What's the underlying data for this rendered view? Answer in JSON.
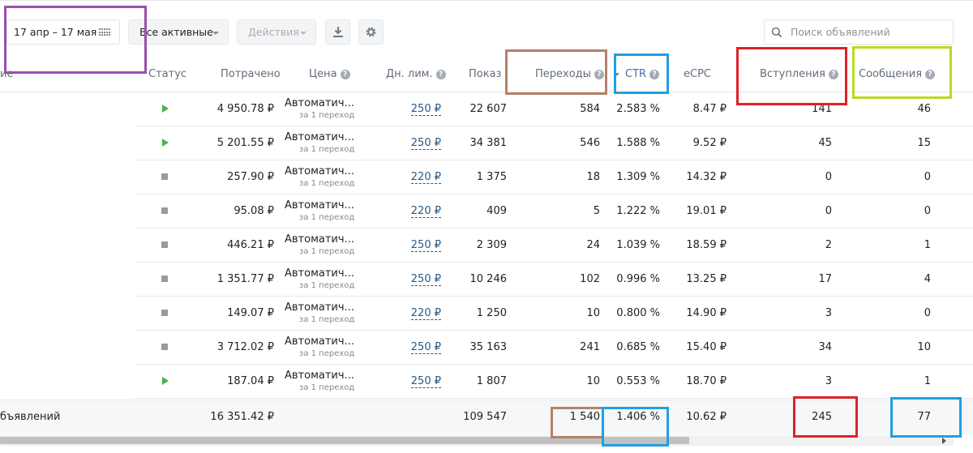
{
  "toolbar": {
    "date_range": "17 апр – 17 мая",
    "filter": "Все активные",
    "actions": "Действия",
    "search_placeholder": "Поиск объявлений"
  },
  "columns": {
    "name_partial": "ие",
    "status": "Статус",
    "spent": "Потрачено",
    "price": "Цена",
    "daily_limit": "Дн. лим.",
    "impressions": "Показ",
    "clicks": "Переходы",
    "ctr": "CTR",
    "ecpc": "eCPC",
    "joins": "Вступления",
    "messages": "Сообщения"
  },
  "rows": [
    {
      "status": "active",
      "spent": "4 950.78 ₽",
      "price": "Автоматич...",
      "price_sub": "за 1 переход",
      "limit": "250 ₽",
      "impressions": "22 607",
      "clicks": "584",
      "ctr": "2.583 %",
      "ecpc": "8.47 ₽",
      "joins": "141",
      "messages": "46"
    },
    {
      "status": "active",
      "spent": "5 201.55 ₽",
      "price": "Автоматич...",
      "price_sub": "за 1 переход",
      "limit": "250 ₽",
      "impressions": "34 381",
      "clicks": "546",
      "ctr": "1.588 %",
      "ecpc": "9.52 ₽",
      "joins": "45",
      "messages": "15"
    },
    {
      "status": "stopped",
      "spent": "257.90 ₽",
      "price": "Автоматич...",
      "price_sub": "за 1 переход",
      "limit": "220 ₽",
      "impressions": "1 375",
      "clicks": "18",
      "ctr": "1.309 %",
      "ecpc": "14.32 ₽",
      "joins": "0",
      "messages": "0"
    },
    {
      "status": "stopped",
      "spent": "95.08 ₽",
      "price": "Автоматич...",
      "price_sub": "за 1 переход",
      "limit": "220 ₽",
      "impressions": "409",
      "clicks": "5",
      "ctr": "1.222 %",
      "ecpc": "19.01 ₽",
      "joins": "0",
      "messages": "0"
    },
    {
      "status": "stopped",
      "spent": "446.21 ₽",
      "price": "Автоматич...",
      "price_sub": "за 1 переход",
      "limit": "250 ₽",
      "impressions": "2 309",
      "clicks": "24",
      "ctr": "1.039 %",
      "ecpc": "18.59 ₽",
      "joins": "2",
      "messages": "1"
    },
    {
      "status": "stopped",
      "spent": "1 351.77 ₽",
      "price": "Автоматич...",
      "price_sub": "за 1 переход",
      "limit": "250 ₽",
      "impressions": "10 246",
      "clicks": "102",
      "ctr": "0.996 %",
      "ecpc": "13.25 ₽",
      "joins": "17",
      "messages": "4"
    },
    {
      "status": "stopped",
      "spent": "149.07 ₽",
      "price": "Автоматич...",
      "price_sub": "за 1 переход",
      "limit": "220 ₽",
      "impressions": "1 250",
      "clicks": "10",
      "ctr": "0.800 %",
      "ecpc": "14.90 ₽",
      "joins": "3",
      "messages": "0"
    },
    {
      "status": "stopped",
      "spent": "3 712.02 ₽",
      "price": "Автоматич...",
      "price_sub": "за 1 переход",
      "limit": "250 ₽",
      "impressions": "35 163",
      "clicks": "241",
      "ctr": "0.685 %",
      "ecpc": "15.40 ₽",
      "joins": "34",
      "messages": "10"
    },
    {
      "status": "active",
      "spent": "187.04 ₽",
      "price": "Автоматич...",
      "price_sub": "за 1 переход",
      "limit": "250 ₽",
      "impressions": "1 807",
      "clicks": "10",
      "ctr": "0.553 %",
      "ecpc": "18.70 ₽",
      "joins": "3",
      "messages": "1"
    }
  ],
  "total": {
    "label": "бъявлений",
    "spent": "16 351.42 ₽",
    "impressions": "109 547",
    "clicks": "1 540",
    "ctr": "1.406 %",
    "ecpc": "10.62 ₽",
    "joins": "245",
    "messages": "77"
  },
  "colors": {
    "link": "#2a5885",
    "status_active": "#4bb34b",
    "status_stopped": "#939ca5",
    "annotation_purple": "#9b4fb0",
    "annotation_brown": "#b4826a",
    "annotation_blue": "#1fa0e6",
    "annotation_red": "#e0202a",
    "annotation_lime": "#b5dc20"
  }
}
